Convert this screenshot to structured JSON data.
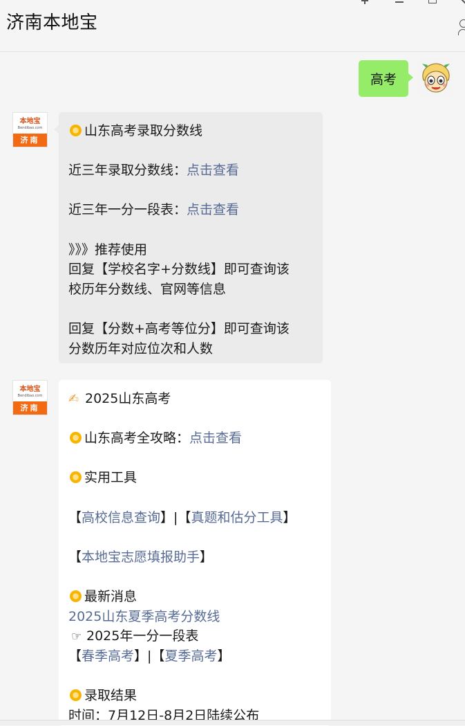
{
  "header": {
    "title": "济南本地宝"
  },
  "user_message": {
    "text": "高考"
  },
  "logo": {
    "brand": "本地宝",
    "url": "Bendibao.com",
    "city": "济南"
  },
  "message1": {
    "heading": "山东高考录取分数线",
    "line2_prefix": "近三年录取分数线：",
    "line2_link": "点击查看",
    "line3_prefix": "近三年一分一段表：",
    "line3_link": "点击查看",
    "recommend": "》》》推荐使用",
    "reply1_a": "回复【学校名字+分数线】即可查询该",
    "reply1_b": "校历年分数线、官网等信息",
    "reply2_a": "回复【分数+高考等位分】即可查询该",
    "reply2_b": "分数历年对应位次和人数"
  },
  "message2": {
    "heading": "2025山东高考",
    "guide_prefix": "山东高考全攻略：",
    "guide_link": "点击查看",
    "tools": "实用工具",
    "tool_open1": "【",
    "tool_link1": "高校信息查询",
    "tool_sep": "】|【",
    "tool_link2": "真题和估分工具",
    "tool_close": "】",
    "helper_open": "【",
    "helper_link": "本地宝志愿填报助手",
    "helper_close": "】",
    "news": "最新消息",
    "news_link": "2025山东夏季高考分数线",
    "news_item": "2025年一分一段表",
    "season_open": "【",
    "season_link1": "春季高考",
    "season_sep": "】|【",
    "season_link2": "夏季高考",
    "season_close": "】",
    "result": "录取结果",
    "time": "时间：7月12日-8月2日陆续公布"
  },
  "colors": {
    "link": "#576b95",
    "bubble_green": "#95ec69",
    "bubble_gray": "#ebebeb",
    "brand_orange": "#f26a13"
  },
  "icons": [
    "pin-icon",
    "minimize-icon",
    "maximize-icon",
    "close-icon",
    "profile-icon",
    "sun-icon",
    "writing-hand-icon",
    "pointing-hand-icon"
  ]
}
